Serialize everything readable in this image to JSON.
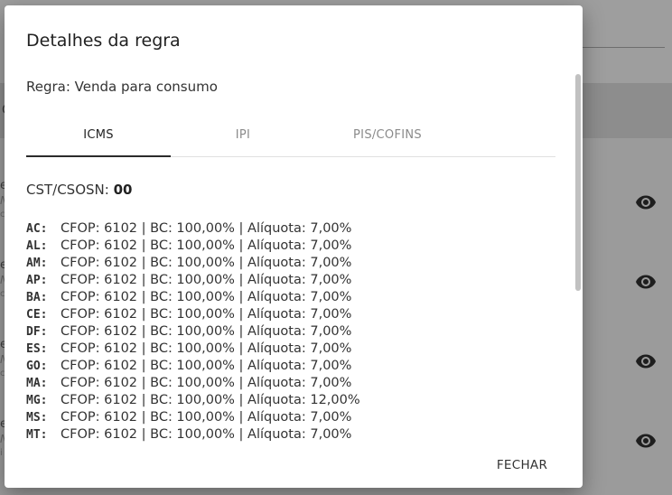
{
  "background": {
    "search_text": "a",
    "header_text": "C",
    "rows": [
      {
        "lead": "e",
        "sub": "N",
        "sub2": "c"
      },
      {
        "lead": "e",
        "sub": "N",
        "sub2": "c"
      },
      {
        "lead": "e",
        "sub": "N",
        "sub2": "c"
      },
      {
        "lead": "e",
        "sub": "N",
        "sub2": "i"
      }
    ]
  },
  "modal": {
    "title": "Detalhes da regra",
    "rule_label": "Regra: Venda para consumo",
    "tabs": [
      {
        "label": "ICMS",
        "active": true
      },
      {
        "label": "IPI",
        "active": false
      },
      {
        "label": "PIS/COFINS",
        "active": false
      }
    ],
    "cst_label": "CST/CSOSN:",
    "cst_value": "00",
    "uf_rows": [
      {
        "uf": "AC:",
        "text": "CFOP: 6102 |  BC: 100,00% | Alíquota: 7,00%"
      },
      {
        "uf": "AL:",
        "text": "CFOP: 6102 |  BC: 100,00% | Alíquota: 7,00%"
      },
      {
        "uf": "AM:",
        "text": "CFOP: 6102 |  BC: 100,00% | Alíquota: 7,00%"
      },
      {
        "uf": "AP:",
        "text": "CFOP: 6102 |  BC: 100,00% | Alíquota: 7,00%"
      },
      {
        "uf": "BA:",
        "text": "CFOP: 6102 |  BC: 100,00% | Alíquota: 7,00%"
      },
      {
        "uf": "CE:",
        "text": "CFOP: 6102 |  BC: 100,00% | Alíquota: 7,00%"
      },
      {
        "uf": "DF:",
        "text": "CFOP: 6102 |  BC: 100,00% | Alíquota: 7,00%"
      },
      {
        "uf": "ES:",
        "text": "CFOP: 6102 |  BC: 100,00% | Alíquota: 7,00%"
      },
      {
        "uf": "GO:",
        "text": "CFOP: 6102 |  BC: 100,00% | Alíquota: 7,00%"
      },
      {
        "uf": "MA:",
        "text": "CFOP: 6102 |  BC: 100,00% | Alíquota: 7,00%"
      },
      {
        "uf": "MG:",
        "text": "CFOP: 6102 |  BC: 100,00% | Alíquota: 12,00%"
      },
      {
        "uf": "MS:",
        "text": "CFOP: 6102 |  BC: 100,00% | Alíquota: 7,00%"
      },
      {
        "uf": "MT:",
        "text": "CFOP: 6102 |  BC: 100,00% | Alíquota: 7,00%"
      }
    ],
    "close_label": "FECHAR"
  },
  "icons": {
    "row_action": "eye-icon"
  }
}
